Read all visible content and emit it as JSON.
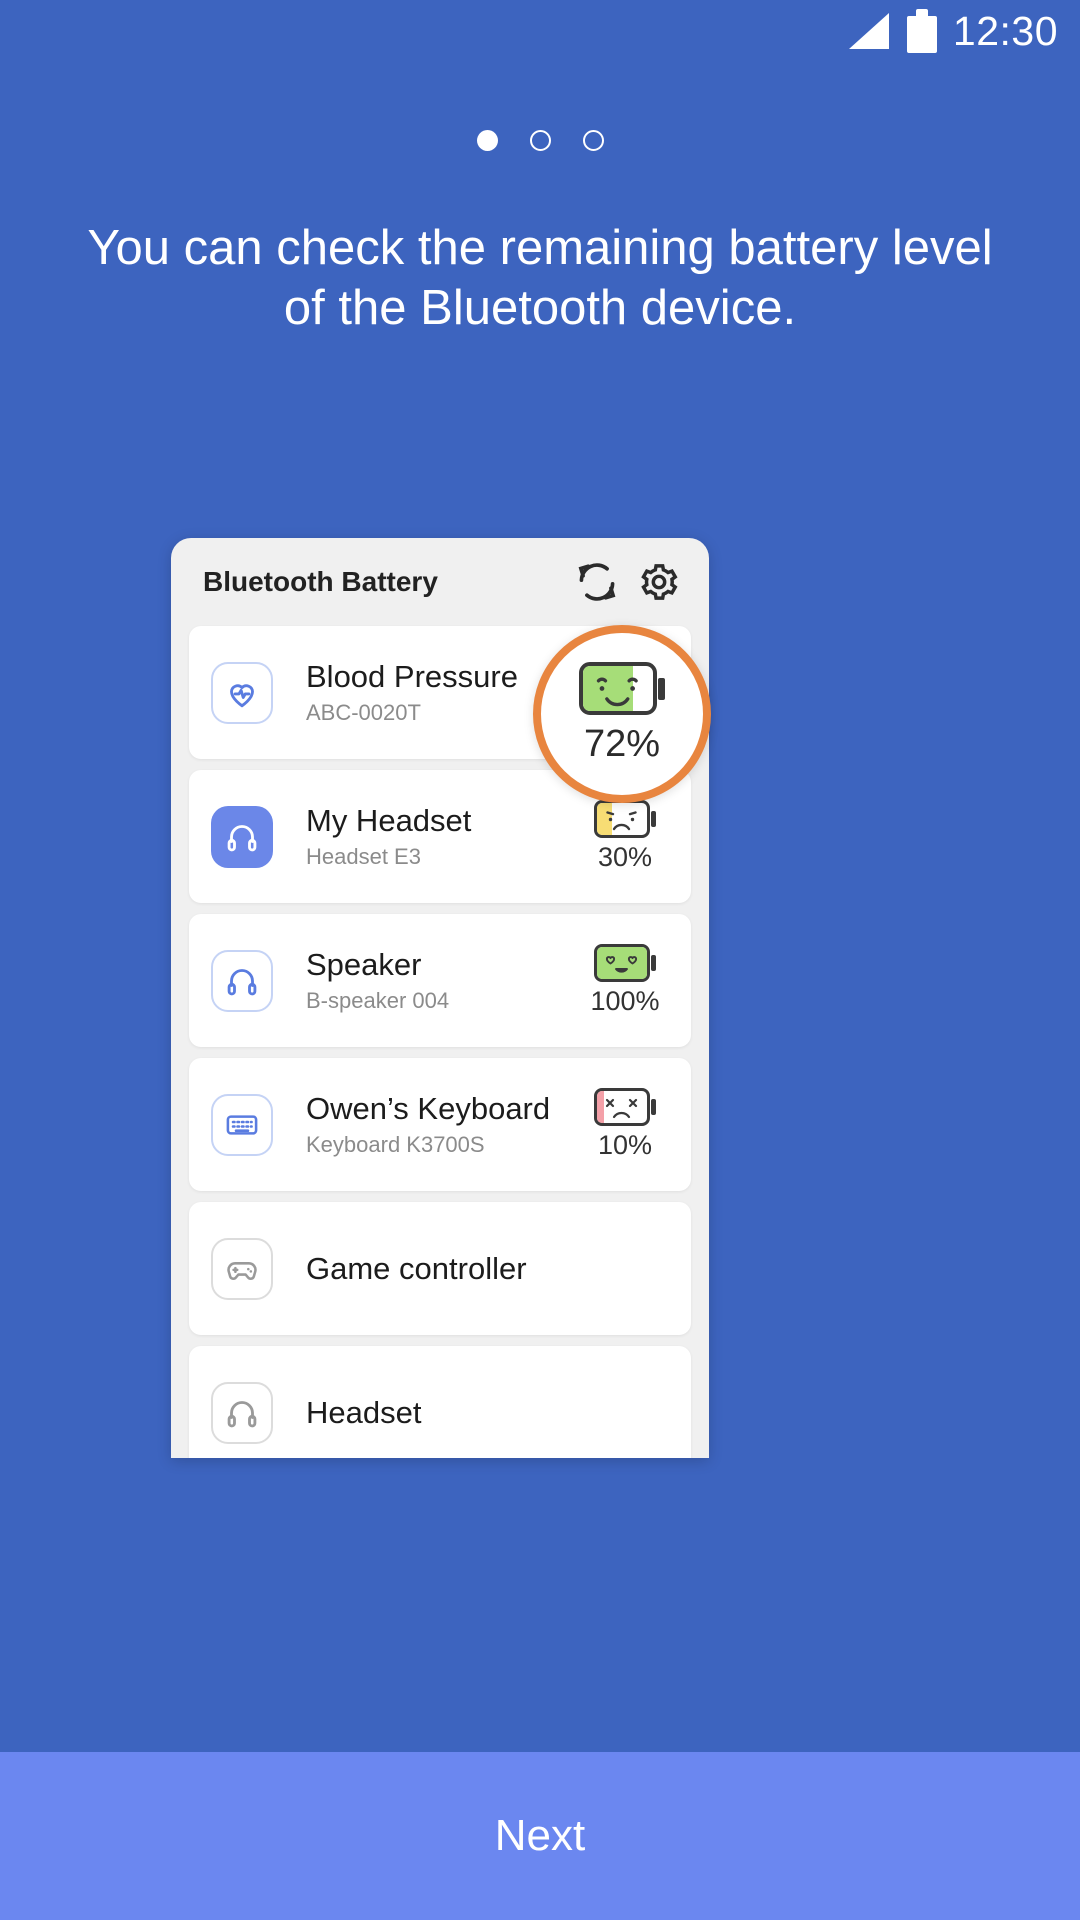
{
  "status_bar": {
    "time": "12:30",
    "signal_icon": "signal-triangle-icon",
    "battery_icon": "battery-icon"
  },
  "pager": {
    "total": 3,
    "active_index": 0
  },
  "headline": "You can check the remaining battery level of the Bluetooth device.",
  "preview_card": {
    "title": "Bluetooth Battery",
    "refresh_icon": "refresh-icon",
    "settings_icon": "gear-icon",
    "devices": [
      {
        "name": "Blood Pressure",
        "sub": "ABC-0020T",
        "icon": "heart-pulse-icon",
        "icon_style": "outline",
        "battery": {
          "percent_label": "72%",
          "percent": 72,
          "fill_color": "#a6dd78",
          "face": "smile"
        }
      },
      {
        "name": "My Headset",
        "sub": "Headset E3",
        "icon": "headphones-icon",
        "icon_style": "filled",
        "battery": {
          "percent_label": "30%",
          "percent": 30,
          "fill_color": "#f7dd74",
          "face": "frown"
        }
      },
      {
        "name": "Speaker",
        "sub": "B-speaker 004",
        "icon": "headphones-icon",
        "icon_style": "outline",
        "battery": {
          "percent_label": "100%",
          "percent": 100,
          "fill_color": "#a6dd78",
          "face": "heart-eyes"
        }
      },
      {
        "name": "Owen’s Keyboard",
        "sub": "Keyboard K3700S",
        "icon": "keyboard-icon",
        "icon_style": "outline",
        "battery": {
          "percent_label": "10%",
          "percent": 10,
          "fill_color": "#f4a0a8",
          "face": "dead"
        }
      },
      {
        "name": "Game controller",
        "sub": "",
        "icon": "gamepad-icon",
        "icon_style": "outline-gray",
        "battery": null
      },
      {
        "name": "Headset",
        "sub": "",
        "icon": "headphones-icon",
        "icon_style": "outline-gray",
        "battery": null
      }
    ]
  },
  "highlight": {
    "percent_label": "72%",
    "accent_color": "#e8853f"
  },
  "next_button": {
    "label": "Next"
  },
  "colors": {
    "background": "#3d64bf",
    "next_bar": "#6b87f0",
    "card_bg": "#f0f0f0",
    "accent_orange": "#e8853f"
  }
}
